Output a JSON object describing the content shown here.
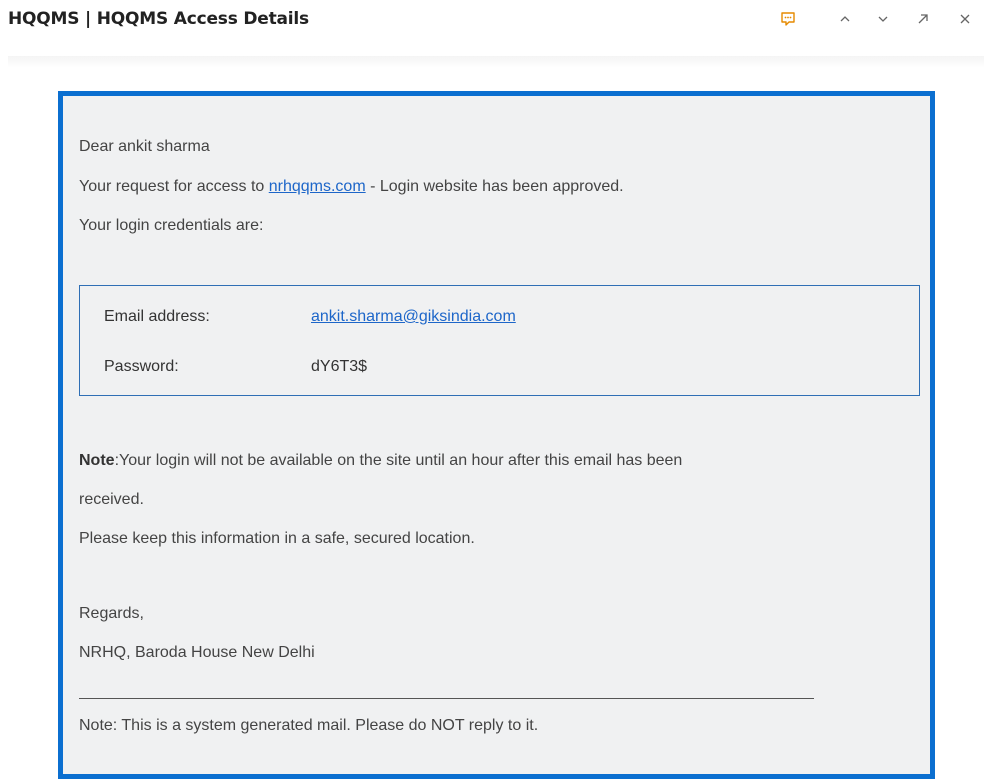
{
  "header": {
    "subject": "HQQMS | HQQMS Access Details",
    "icons": [
      "conversation-icon",
      "chevron-up-icon",
      "chevron-down-icon",
      "expand-icon",
      "close-icon"
    ],
    "accent_color": "#e58a00"
  },
  "email": {
    "frame_color": "#0b6fd0",
    "greeting": "Dear ankit sharma",
    "request_prefix": "Your request for access to ",
    "request_link": "nrhqqms.com",
    "request_suffix": " - Login website has been approved.",
    "credentials_intro": "Your login credentials are:",
    "credentials": {
      "email_label": "Email address:",
      "email_value": "ankit.sharma@giksindia.com",
      "password_label": "Password:",
      "password_value": "dY6T3$"
    },
    "note_strong": "Note",
    "note_line1": ":Your login will not be available on the site until an hour after this email has been",
    "note_line2": "received.",
    "keep_safe": "Please keep this information in a safe, secured location.",
    "regards": "Regards,",
    "signature": "NRHQ, Baroda House New Delhi",
    "system_note": "Note: This is a system generated mail. Please do NOT reply to it."
  }
}
